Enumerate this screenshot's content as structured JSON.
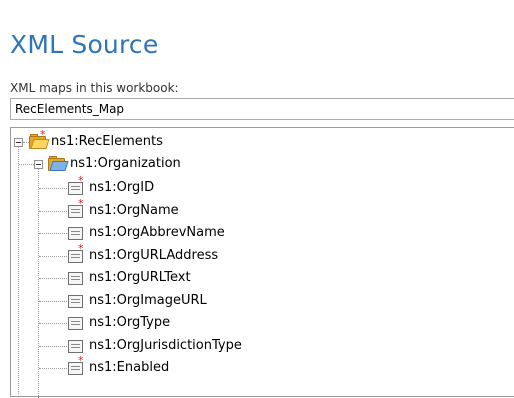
{
  "pane": {
    "title": "XML Source",
    "maps_label": "XML maps in this workbook:",
    "selected_map": "RecElements_Map"
  },
  "tree": {
    "root": {
      "label": "ns1:RecElements",
      "icon": "folder-required-icon"
    },
    "child": {
      "label": "ns1:Organization",
      "icon": "folder-repeating-icon"
    },
    "elements": [
      {
        "label": "ns1:OrgID",
        "required": true
      },
      {
        "label": "ns1:OrgName",
        "required": true
      },
      {
        "label": "ns1:OrgAbbrevName",
        "required": false
      },
      {
        "label": "ns1:OrgURLAddress",
        "required": true
      },
      {
        "label": "ns1:OrgURLText",
        "required": false
      },
      {
        "label": "ns1:OrgImageURL",
        "required": false
      },
      {
        "label": "ns1:OrgType",
        "required": false
      },
      {
        "label": "ns1:OrgJurisdictionType",
        "required": false
      },
      {
        "label": "ns1:Enabled",
        "required": true
      }
    ]
  }
}
